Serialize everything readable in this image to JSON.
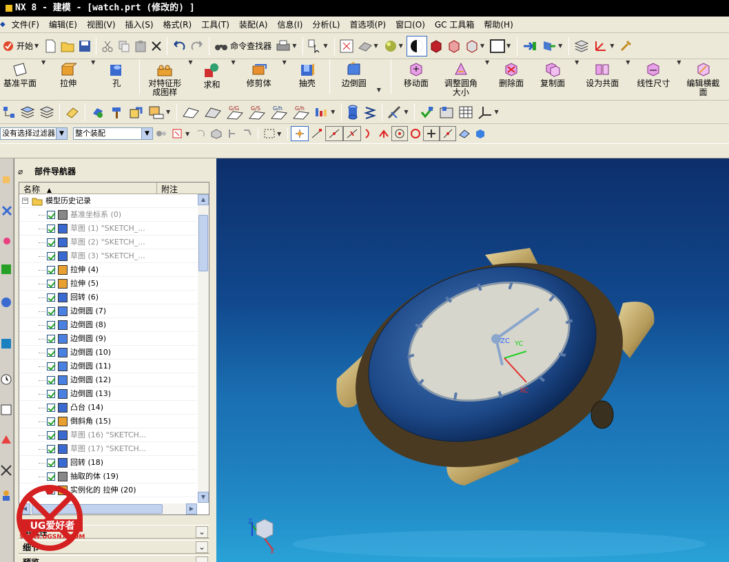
{
  "app": {
    "title": "NX 8 - 建模 - [watch.prt (修改的) ]"
  },
  "menus": [
    "文件(F)",
    "编辑(E)",
    "视图(V)",
    "插入(S)",
    "格式(R)",
    "工具(T)",
    "装配(A)",
    "信息(I)",
    "分析(L)",
    "首选项(P)",
    "窗口(O)",
    "GC 工具箱",
    "帮助(H)"
  ],
  "toolbar1": {
    "start_label": "开始",
    "command_finder_label": "命令查找器"
  },
  "toolbar2": {
    "items": [
      {
        "label": "基准平面",
        "icon": "datum-plane-icon"
      },
      {
        "label": "拉伸",
        "icon": "extrude-icon"
      },
      {
        "label": "孔",
        "icon": "hole-icon"
      },
      {
        "label": "对特征形\n成图样",
        "icon": "pattern-feature-icon"
      },
      {
        "label": "求和",
        "icon": "unite-icon"
      },
      {
        "label": "修剪体",
        "icon": "trim-body-icon"
      },
      {
        "label": "抽壳",
        "icon": "shell-icon"
      },
      {
        "label": "边倒圆",
        "icon": "edge-blend-icon"
      },
      {
        "label": "移动面",
        "icon": "move-face-icon"
      },
      {
        "label": "调整圆角\n大小",
        "icon": "resize-blend-icon"
      },
      {
        "label": "删除面",
        "icon": "delete-face-icon"
      },
      {
        "label": "复制面",
        "icon": "copy-face-icon"
      },
      {
        "label": "设为共面",
        "icon": "make-coplanar-icon"
      },
      {
        "label": "线性尺寸",
        "icon": "linear-dimension-icon"
      },
      {
        "label": "编辑横截\n面",
        "icon": "edit-cross-section-icon"
      }
    ]
  },
  "selection": {
    "filter_value": "没有选择过滤器",
    "scope_value": "整个装配"
  },
  "navigator": {
    "title": "部件导航器",
    "col_name": "名称",
    "col_note": "附注",
    "root_label": "模型历史记录",
    "rows": [
      {
        "label": "基准坐标系 (0)",
        "icon": "datum-csys-icon",
        "dim": true
      },
      {
        "label": "草图 (1) \"SKETCH_...",
        "icon": "sketch-icon",
        "dim": true
      },
      {
        "label": "草图 (2) \"SKETCH_...",
        "icon": "sketch-icon",
        "dim": true
      },
      {
        "label": "草图 (3) \"SKETCH_...",
        "icon": "sketch-icon",
        "dim": true
      },
      {
        "label": "拉伸 (4)",
        "icon": "extrude-icon",
        "dim": false
      },
      {
        "label": "拉伸 (5)",
        "icon": "extrude-icon",
        "dim": false
      },
      {
        "label": "回转 (6)",
        "icon": "revolve-icon",
        "dim": false
      },
      {
        "label": "边倒圆 (7)",
        "icon": "edge-blend-icon",
        "dim": false
      },
      {
        "label": "边倒圆 (8)",
        "icon": "edge-blend-icon",
        "dim": false
      },
      {
        "label": "边倒圆 (9)",
        "icon": "edge-blend-icon",
        "dim": false
      },
      {
        "label": "边倒圆 (10)",
        "icon": "edge-blend-icon",
        "dim": false
      },
      {
        "label": "边倒圆 (11)",
        "icon": "edge-blend-icon",
        "dim": false
      },
      {
        "label": "边倒圆 (12)",
        "icon": "edge-blend-icon",
        "dim": false
      },
      {
        "label": "边倒圆 (13)",
        "icon": "edge-blend-icon",
        "dim": false
      },
      {
        "label": "凸台 (14)",
        "icon": "boss-icon",
        "dim": false
      },
      {
        "label": "倒斜角 (15)",
        "icon": "chamfer-icon",
        "dim": false
      },
      {
        "label": "草图 (16) \"SKETCH...",
        "icon": "sketch-icon",
        "dim": true
      },
      {
        "label": "草图 (17) \"SKETCH...",
        "icon": "sketch-icon",
        "dim": true
      },
      {
        "label": "回转 (18)",
        "icon": "revolve-icon",
        "dim": false
      },
      {
        "label": "抽取的体 (19)",
        "icon": "extract-body-icon",
        "dim": false
      },
      {
        "label": "实例化的 拉伸 (20)",
        "icon": "instance-extrude-icon",
        "dim": false
      }
    ],
    "sections": [
      "相依性",
      "细节",
      "预览"
    ]
  },
  "viewport": {
    "axis_zc": "ZC",
    "axis_yc": "YC",
    "axis_xc": "XC",
    "triad_z": "Z",
    "triad_x": "X"
  },
  "watermark": {
    "brand": "UG爱好者",
    "url": "WWW.UGSNX.COM"
  }
}
